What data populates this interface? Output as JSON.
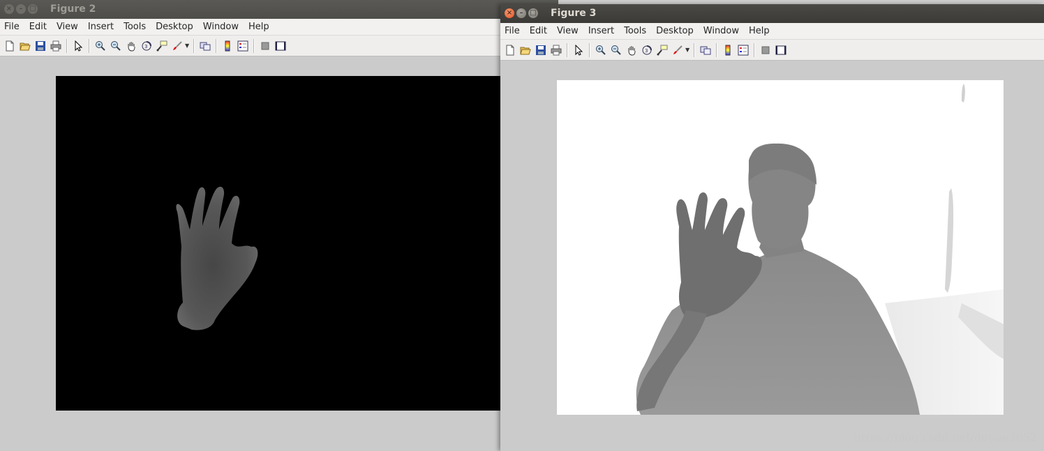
{
  "figure2": {
    "title": "Figure 2",
    "menu": [
      "File",
      "Edit",
      "View",
      "Insert",
      "Tools",
      "Desktop",
      "Window",
      "Help"
    ],
    "menu_mnemonic": [
      "F",
      "E",
      "V",
      "I",
      "T",
      "D",
      "W",
      "H"
    ]
  },
  "figure3": {
    "title": "Figure 3",
    "menu": [
      "File",
      "Edit",
      "View",
      "Insert",
      "Tools",
      "Desktop",
      "Window",
      "Help"
    ]
  },
  "window_buttons": {
    "close": "×",
    "minimize": "–",
    "maximize": "□"
  },
  "toolbar_icons": [
    "new-figure-icon",
    "open-file-icon",
    "save-figure-icon",
    "print-figure-icon",
    "edit-plot-icon",
    "zoom-in-icon",
    "zoom-out-icon",
    "pan-icon",
    "rotate-3d-icon",
    "data-cursor-icon",
    "brush-icon",
    "link-plot-icon",
    "insert-colorbar-icon",
    "insert-legend-icon",
    "hide-plot-tools-icon",
    "show-plot-tools-icon"
  ],
  "watermark": "https://blog.csdn.net/duyue3052",
  "colors": {
    "titlebar_active": "#3b3a36",
    "close_button": "#e2531e",
    "figure_bg": "#cbcbcb",
    "depth_mask_bg": "#000000",
    "depth_image_bg": "#ffffff"
  }
}
